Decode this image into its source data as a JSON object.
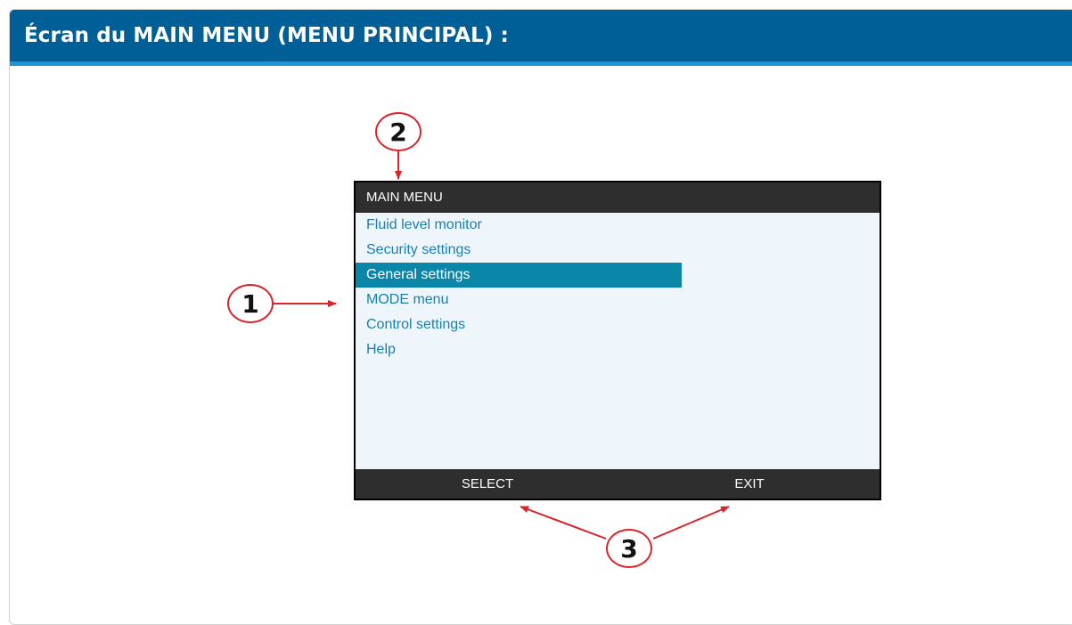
{
  "header": {
    "title": "Écran du MAIN MENU (MENU PRINCIPAL) :"
  },
  "device_screen": {
    "title": "MAIN MENU",
    "menu_items": [
      {
        "label": "Fluid level monitor",
        "selected": false
      },
      {
        "label": "Security settings",
        "selected": false
      },
      {
        "label": "General settings",
        "selected": true
      },
      {
        "label": "MODE menu",
        "selected": false
      },
      {
        "label": "Control settings",
        "selected": false
      },
      {
        "label": "Help",
        "selected": false
      }
    ],
    "softkeys": {
      "left": "SELECT",
      "right": "EXIT"
    }
  },
  "callouts": {
    "one": "1",
    "two": "2",
    "three": "3"
  },
  "colors": {
    "header_bg": "#005f96",
    "header_accent": "#1d95d8",
    "selected_item_bg": "#0a86a8",
    "menu_text": "#1a80ab",
    "screen_bar": "#2e2e2e",
    "callout_red": "#d7262b"
  }
}
